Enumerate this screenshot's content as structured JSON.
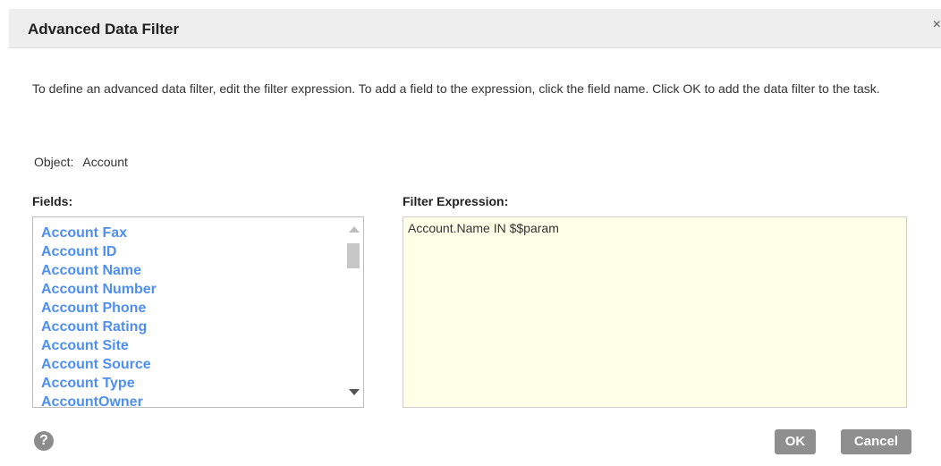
{
  "dialog": {
    "title": "Advanced Data Filter",
    "close_glyph": "×"
  },
  "instructions": "To define an advanced data filter, edit the filter expression. To add a field to the expression, click the field name. Click OK to add the data filter to the task.",
  "object": {
    "label": "Object:",
    "value": "Account"
  },
  "fields": {
    "label": "Fields:",
    "items": [
      "Account Fax",
      "Account ID",
      "Account Name",
      "Account Number",
      "Account Phone",
      "Account Rating",
      "Account Site",
      "Account Source",
      "Account Type",
      "AccountOwner"
    ]
  },
  "filter": {
    "label": "Filter Expression:",
    "value": "Account.Name IN $$param"
  },
  "footer": {
    "help_glyph": "?",
    "ok_label": "OK",
    "cancel_label": "Cancel"
  },
  "icons": {
    "close": "close-icon",
    "help": "help-icon",
    "scroll_up": "scroll-up-arrow-icon",
    "scroll_down": "scroll-down-arrow-icon"
  },
  "colors": {
    "field_link": "#4f8ff0",
    "filter_bg": "#ffffe8",
    "button_bg": "#8f8f8f",
    "titlebar_bg": "#eeeeee"
  }
}
